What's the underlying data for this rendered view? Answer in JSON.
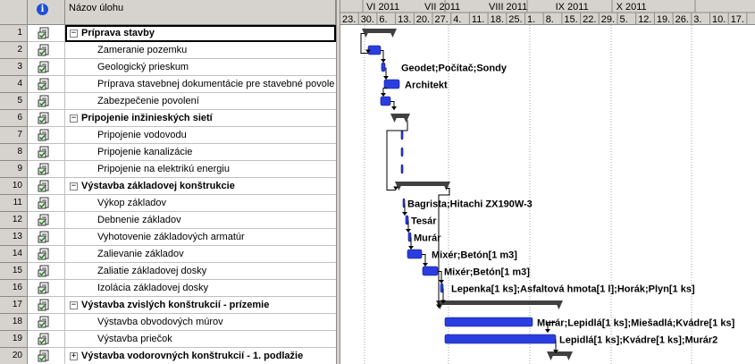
{
  "header": {
    "id_col": "",
    "info_col": "i",
    "name_col": "Názov úlohu"
  },
  "timescale": {
    "months": [
      "VI 2011",
      "VII 2011",
      "VIII 2011",
      "IX 2011",
      "X 2011"
    ],
    "weeks": [
      "23.",
      "30.",
      "6.",
      "13.",
      "20.",
      "27.",
      "4.",
      "11.",
      "18.",
      "25.",
      "1.",
      "8.",
      "15.",
      "22.",
      "29.",
      "5.",
      "12.",
      "19.",
      "26.",
      "3.",
      "10.",
      "17."
    ]
  },
  "tasks": [
    {
      "id": "1",
      "name": "Príprava stavby",
      "summary": true,
      "toggle": "−"
    },
    {
      "id": "2",
      "name": "Zameranie pozemku"
    },
    {
      "id": "3",
      "name": "Geologický prieskum",
      "resource": "Geodet;Počítač;Sondy"
    },
    {
      "id": "4",
      "name": "Príprava stavebnej dokumentácie pre stavebné povole",
      "resource": "Architekt"
    },
    {
      "id": "5",
      "name": "Zabezpečenie povolení"
    },
    {
      "id": "6",
      "name": "Pripojenie inžinieských sietí",
      "summary": true,
      "toggle": "−"
    },
    {
      "id": "7",
      "name": "Pripojenie vodovodu"
    },
    {
      "id": "8",
      "name": "Pripojenie kanalizácie"
    },
    {
      "id": "9",
      "name": "Pripojenie na elektrikú energiu"
    },
    {
      "id": "10",
      "name": "Výstavba základovej konštrukcie",
      "summary": true,
      "toggle": "−"
    },
    {
      "id": "11",
      "name": "Výkop základov",
      "resource": "Bagrista;Hitachi ZX190W-3"
    },
    {
      "id": "12",
      "name": "Debnenie základov",
      "resource": "Tesár"
    },
    {
      "id": "13",
      "name": "Vyhotovenie základových armatúr",
      "resource": "Murár"
    },
    {
      "id": "14",
      "name": "Zalievanie základov",
      "resource": "Mixér;Betón[1 m3]"
    },
    {
      "id": "15",
      "name": "Zaliatie základovej dosky",
      "resource": "Mixér;Betón[1 m3]"
    },
    {
      "id": "16",
      "name": "Izolácia základovej dosky",
      "resource": "Lepenka[1 ks];Asfaltová hmota[1 l];Horák;Plyn[1 ks]"
    },
    {
      "id": "17",
      "name": "Výstavba zvislých konštrukcií - prízemie",
      "summary": true,
      "toggle": "−"
    },
    {
      "id": "18",
      "name": "Výstavba obvodových múrov",
      "resource": "Murár;Lepidlá[1 ks];Miešadlá;Kvádre[1 ks]"
    },
    {
      "id": "19",
      "name": "Výstavba priečok",
      "resource": "Lepidlá[1 ks];Kvádre[1 ks];Murár2"
    },
    {
      "id": "20",
      "name": "Výstavba vodorovných konštrukcií - 1. podlažie",
      "summary": true,
      "toggle": "+"
    }
  ],
  "colors": {
    "task_bar": "#2a3ee0",
    "summary_bar": "#404040",
    "link": "#000000",
    "header_bg": "#d6d3ce"
  },
  "icons": {
    "info": "info-icon",
    "indicator": "notes-indicator-icon"
  }
}
